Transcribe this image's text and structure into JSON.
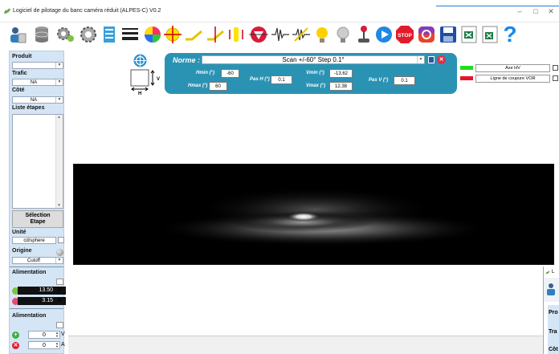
{
  "window": {
    "title": "Logiciel de pilotage du banc caméra réduit (ALPES-C) V0.2",
    "min_glyph": "–",
    "max_glyph": "□",
    "close_glyph": "✕"
  },
  "toolbar": {
    "icons": [
      "users-icon",
      "database-icon",
      "settings-gears-icon",
      "list-icon",
      "lines-icon",
      "color-wheel-icon",
      "crosshair-icon",
      "angled-line-icon",
      "crosshair-line-icon",
      "focus-lines-icon",
      "triangle-target-icon",
      "waveform-icon",
      "waveform-cut-icon",
      "bulb-on-icon",
      "bulb-off-icon",
      "joystick-icon",
      "play-icon",
      "stop-icon",
      "camera-icon",
      "save-icon",
      "excel-icon",
      "excel-export-icon",
      "help-icon"
    ],
    "stop_label": "STOP",
    "help_label": "?"
  },
  "sidebar": {
    "produit_label": "Produit",
    "produit_value": "",
    "trafic_label": "Trafic",
    "trafic_value": "NA",
    "cote_label": "Côté",
    "cote_value": "NA",
    "liste_label": "Liste étapes",
    "selection_button": "Sélection\nEtape",
    "unite_label": "Unité",
    "unite_value": "cd/sphere",
    "origine_label": "Origine",
    "origine_value": "Cutoff",
    "alimentation1_label": "Alimentation",
    "voltage": "13.50",
    "voltage_unit": "V",
    "current": "3.15",
    "current_unit": "A",
    "alimentation2_label": "Alimentation",
    "spin_v": "0",
    "spin_v_unit": "V",
    "spin_a": "0",
    "spin_a_unit": "A",
    "add_glyph": "+",
    "remove_glyph": "✕"
  },
  "norme": {
    "label": "Norme :",
    "value": "Scan +/-60° Step 0.1°",
    "hmin_label": "Hmin (°)",
    "hmin": "-60",
    "hmax_label": "Hmax (°)",
    "hmax": "60",
    "pash_label": "Pas H (°)",
    "pash": "0.1",
    "vmin_label": "Vmin (°)",
    "vmin": "-13.62",
    "vmax_label": "Vmax (°)",
    "vmax": "12.38",
    "pasv_label": "Pas V (°)",
    "pasv": "0.1",
    "close_glyph": "✕"
  },
  "frame": {
    "h_label": "H",
    "v_label": "V"
  },
  "legend": [
    {
      "color": "#22dd22",
      "label": "Axe HV"
    },
    {
      "color": "#e8142a",
      "label": "Ligne de coupure VOR"
    }
  ],
  "second_window": {
    "title": "L",
    "produit": "Pro",
    "trafic": "Tra",
    "cote": "Côt"
  }
}
